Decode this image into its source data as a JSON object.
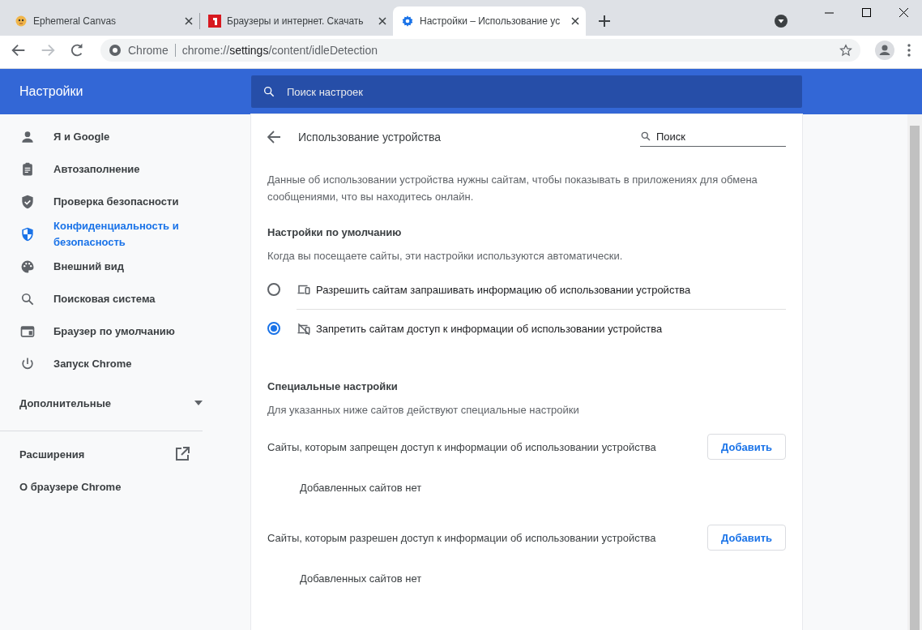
{
  "tabs": [
    {
      "title": "Ephemeral Canvas",
      "selected": false
    },
    {
      "title": "Браузеры и интернет. Скачать",
      "selected": false
    },
    {
      "title": "Настройки – Использование ус",
      "selected": true
    }
  ],
  "address": {
    "origin": "Chrome",
    "url_scheme": "chrome://",
    "url_host": "settings",
    "url_path": "/content/idleDetection"
  },
  "header": {
    "title": "Настройки",
    "search_placeholder": "Поиск настроек"
  },
  "sidebar": {
    "items": [
      {
        "label": "Я и Google",
        "selected": false
      },
      {
        "label": "Автозаполнение",
        "selected": false
      },
      {
        "label": "Проверка безопасности",
        "selected": false
      },
      {
        "label": "Конфиденциальность и безопасность",
        "selected": true
      },
      {
        "label": "Внешний вид",
        "selected": false
      },
      {
        "label": "Поисковая система",
        "selected": false
      },
      {
        "label": "Браузер по умолчанию",
        "selected": false
      },
      {
        "label": "Запуск Chrome",
        "selected": false
      }
    ],
    "advanced": {
      "label": "Дополнительные",
      "expanded": false
    },
    "extensions": "Расширения",
    "about": "О браузере Chrome"
  },
  "page": {
    "title": "Использование устройства",
    "search_placeholder": "Поиск",
    "description": "Данные об использовании устройства нужны сайтам, чтобы показывать в приложениях для обмена сообщениями, что вы находитесь онлайн.",
    "default_heading": "Настройки по умолчанию",
    "default_subtitle": "Когда вы посещаете сайты, эти настройки используются автоматически.",
    "options": [
      {
        "label": "Разрешить сайтам запрашивать информацию об использовании устройства",
        "selected": false
      },
      {
        "label": "Запретить сайтам доступ к информации об использовании устройства",
        "selected": true
      }
    ],
    "custom_heading": "Специальные настройки",
    "custom_subtitle": "Для указанных ниже сайтов действуют специальные настройки",
    "lists": [
      {
        "label": "Сайты, которым запрещен доступ к информации об использовании устройства",
        "button": "Добавить",
        "empty": "Добавленных сайтов нет"
      },
      {
        "label": "Сайты, которым разрешен доступ к информации об использовании устройства",
        "button": "Добавить",
        "empty": "Добавленных сайтов нет"
      }
    ]
  }
}
